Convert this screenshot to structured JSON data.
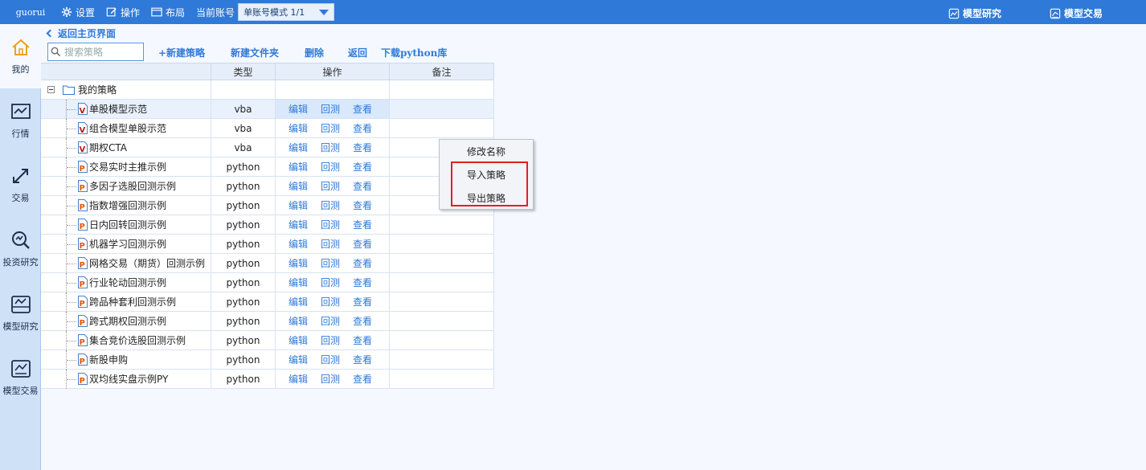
{
  "topbar": {
    "user": "guorui",
    "settings": "设置",
    "operate": "操作",
    "layout": "布局",
    "account_label": "当前账号",
    "account_mode": "单账号模式 1/1",
    "model_research": "模型研究",
    "model_trade": "模型交易"
  },
  "sidebar": [
    {
      "label": "我的",
      "icon": "home-icon"
    },
    {
      "label": "行情",
      "icon": "chart-icon"
    },
    {
      "label": "交易",
      "icon": "exchange-icon"
    },
    {
      "label": "投资研究",
      "icon": "research-icon"
    },
    {
      "label": "模型研究",
      "icon": "model-icon"
    },
    {
      "label": "模型交易",
      "icon": "model-trade-icon"
    }
  ],
  "content": {
    "back": "返回主页界面",
    "search_placeholder": "搜索策略",
    "toolbar": {
      "new_strategy": "+新建策略",
      "new_folder": "新建文件夹",
      "delete": "删除",
      "back": "返回",
      "download": "下载python库"
    },
    "columns": {
      "type": "类型",
      "op": "操作",
      "note": "备注"
    },
    "root": "我的策略",
    "ops": {
      "edit": "编辑",
      "backtest": "回测",
      "view": "查看"
    },
    "rows": [
      {
        "name": "单股模型示范",
        "type": "vba"
      },
      {
        "name": "组合模型单股示范",
        "type": "vba"
      },
      {
        "name": "期权CTA",
        "type": "vba"
      },
      {
        "name": "交易实时主推示例",
        "type": "python"
      },
      {
        "name": "多因子选股回测示例",
        "type": "python"
      },
      {
        "name": "指数增强回测示例",
        "type": "python"
      },
      {
        "name": "日内回转回测示例",
        "type": "python"
      },
      {
        "name": "机器学习回测示例",
        "type": "python"
      },
      {
        "name": "网格交易（期货）回测示例",
        "type": "python"
      },
      {
        "name": "行业轮动回测示例",
        "type": "python"
      },
      {
        "name": "跨品种套利回测示例",
        "type": "python"
      },
      {
        "name": "跨式期权回测示例",
        "type": "python"
      },
      {
        "name": "集合竞价选股回测示例",
        "type": "python"
      },
      {
        "name": "新股申购",
        "type": "python"
      },
      {
        "name": "双均线实盘示例PY",
        "type": "python"
      }
    ]
  },
  "context_menu": {
    "rename": "修改名称",
    "import": "导入策略",
    "export": "导出策略"
  },
  "colors": {
    "accent": "#2f79d8",
    "highlight": "#e02020"
  }
}
